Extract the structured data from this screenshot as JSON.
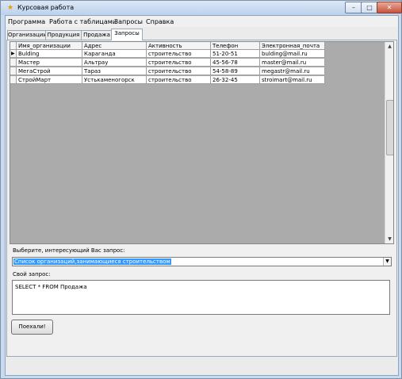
{
  "window": {
    "title": "Курсовая работа",
    "controls": {
      "minimize": "–",
      "maximize": "□",
      "close": "✕"
    }
  },
  "menu": [
    "Программа",
    "Работа с таблицами",
    "Запросы",
    "Справка"
  ],
  "tabs": [
    "Организации",
    "Продукция",
    "Продажа",
    "Запросы"
  ],
  "active_tab": "Запросы",
  "grid": {
    "columns": [
      "Имя_организации",
      "Адрес",
      "Активность",
      "Телефон",
      "Электронная_почта"
    ],
    "rows": [
      [
        "Bulding",
        "Караганда",
        "строительство",
        "51-20-51",
        "bulding@mail.ru"
      ],
      [
        "Мастер",
        "Альтрау",
        "строительство",
        "45-56-78",
        "master@mail.ru"
      ],
      [
        "МегаСтрой",
        "Тараз",
        "строительство",
        "54-58-89",
        "megastr@mail.ru"
      ],
      [
        "СтройМарт",
        "Устькаменогорск",
        "строительство",
        "26-32-45",
        "stroimart@mail.ru"
      ]
    ],
    "current_row_marker": "▶"
  },
  "query_select": {
    "label": "Выберите, интересующий Вас запрос:",
    "value": "Список организаций,занимающиеся строительством"
  },
  "custom_query": {
    "label": "Свой запрос:",
    "value": "SELECT * FROM Продажа"
  },
  "run_button": "Поехали!"
}
